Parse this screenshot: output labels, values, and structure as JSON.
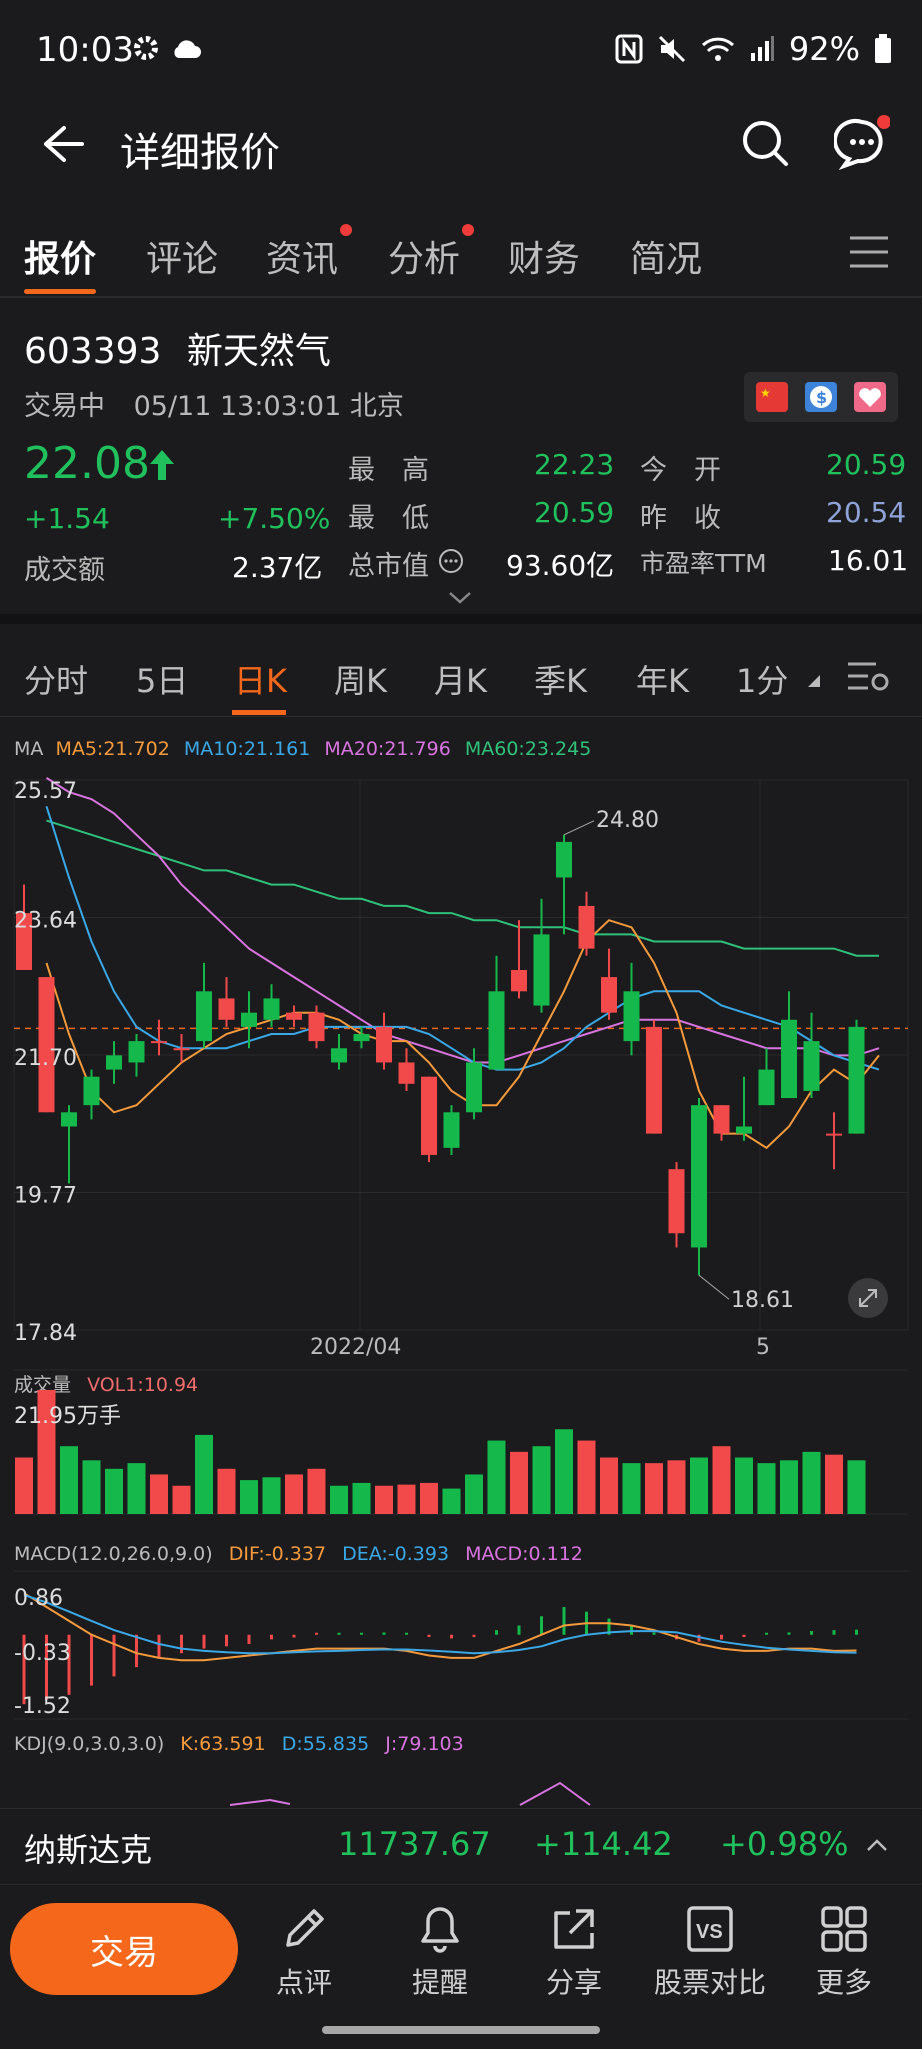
{
  "status": {
    "time": "10:03",
    "battery": "92%"
  },
  "header": {
    "title": "详细报价"
  },
  "tabs": [
    {
      "label": "报价",
      "active": true,
      "dot": false
    },
    {
      "label": "评论",
      "active": false,
      "dot": false
    },
    {
      "label": "资讯",
      "active": false,
      "dot": true
    },
    {
      "label": "分析",
      "active": false,
      "dot": true
    },
    {
      "label": "财务",
      "active": false,
      "dot": false
    },
    {
      "label": "简况",
      "active": false,
      "dot": false
    }
  ],
  "stock": {
    "code": "603393",
    "name": "新天然气",
    "status": "交易中",
    "datetime": "05/11 13:03:01 北京",
    "price": "22.08",
    "change": "+1.54",
    "change_pct": "+7.50%",
    "turnover_label": "成交额",
    "turnover": "2.37亿",
    "high_label": "最　高",
    "high": "22.23",
    "low_label": "最　低",
    "low": "20.59",
    "mcap_label": "总市值",
    "mcap": "93.60亿",
    "open_label": "今　开",
    "open": "20.59",
    "prev_close_label": "昨　收",
    "prev_close": "20.54",
    "pe_label": "市盈率TTM",
    "pe": "16.01"
  },
  "chart_tabs": [
    "分时",
    "5日",
    "日K",
    "周K",
    "月K",
    "季K",
    "年K",
    "1分"
  ],
  "chart_active_tab": "日K",
  "ma_legend": {
    "label": "MA",
    "ma5": "MA5:21.702",
    "ma10": "MA10:21.161",
    "ma20": "MA20:21.796",
    "ma60": "MA60:23.245"
  },
  "volume_legend": {
    "label": "成交量",
    "vol1": "VOL1:10.94",
    "max": "21.95万手"
  },
  "macd_legend": {
    "label": "MACD(12.0,26.0,9.0)",
    "dif": "DIF:-0.337",
    "dea": "DEA:-0.393",
    "macd": "MACD:0.112"
  },
  "kdj_legend": {
    "label": "KDJ(9.0,3.0,3.0)",
    "k": "K:63.591",
    "d": "D:55.835",
    "j": "J:79.103"
  },
  "colors": {
    "up": "#f24a4a",
    "down": "#14b84b",
    "ma5": "#f59a3c",
    "ma10": "#3aa8e6",
    "ma20": "#d874df",
    "ma60": "#2fc17a",
    "accent": "#f5681c"
  },
  "chart_data": {
    "type": "candlestick",
    "ylim": [
      17.84,
      25.57
    ],
    "y_ticks": [
      "25.57",
      "23.64",
      "21.70",
      "19.77",
      "17.84"
    ],
    "x_ticks": [
      "2022/04",
      "5"
    ],
    "annotations": [
      "24.80",
      "18.61"
    ],
    "last_price": 22.08,
    "candles": [
      {
        "o": 22.9,
        "c": 23.7,
        "h": 24.1,
        "l": 22.9,
        "up": true
      },
      {
        "o": 20.9,
        "c": 22.8,
        "h": 22.8,
        "l": 20.9,
        "up": true
      },
      {
        "o": 20.7,
        "c": 20.9,
        "h": 21.0,
        "l": 19.9,
        "up": false
      },
      {
        "o": 21.0,
        "c": 21.4,
        "h": 21.5,
        "l": 20.8,
        "up": false
      },
      {
        "o": 21.5,
        "c": 21.7,
        "h": 21.9,
        "l": 21.3,
        "up": false
      },
      {
        "o": 21.6,
        "c": 21.9,
        "h": 22.0,
        "l": 21.4,
        "up": false
      },
      {
        "o": 21.9,
        "c": 21.9,
        "h": 22.2,
        "l": 21.7,
        "up": true
      },
      {
        "o": 21.8,
        "c": 21.8,
        "h": 22.0,
        "l": 21.6,
        "up": true
      },
      {
        "o": 21.9,
        "c": 22.6,
        "h": 23.0,
        "l": 21.8,
        "up": false
      },
      {
        "o": 22.2,
        "c": 22.5,
        "h": 22.8,
        "l": 22.1,
        "up": true
      },
      {
        "o": 22.1,
        "c": 22.3,
        "h": 22.6,
        "l": 21.8,
        "up": false
      },
      {
        "o": 22.2,
        "c": 22.5,
        "h": 22.7,
        "l": 22.1,
        "up": false
      },
      {
        "o": 22.3,
        "c": 22.2,
        "h": 22.4,
        "l": 22.1,
        "up": true
      },
      {
        "o": 21.9,
        "c": 22.3,
        "h": 22.4,
        "l": 21.8,
        "up": true
      },
      {
        "o": 21.8,
        "c": 21.6,
        "h": 22.0,
        "l": 21.5,
        "up": false
      },
      {
        "o": 21.9,
        "c": 22.0,
        "h": 22.1,
        "l": 21.8,
        "up": false
      },
      {
        "o": 21.6,
        "c": 22.1,
        "h": 22.3,
        "l": 21.5,
        "up": true
      },
      {
        "o": 21.3,
        "c": 21.6,
        "h": 21.8,
        "l": 21.2,
        "up": true
      },
      {
        "o": 20.3,
        "c": 21.4,
        "h": 21.4,
        "l": 20.2,
        "up": true
      },
      {
        "o": 20.4,
        "c": 20.9,
        "h": 21.0,
        "l": 20.3,
        "up": false
      },
      {
        "o": 20.9,
        "c": 21.6,
        "h": 21.8,
        "l": 20.8,
        "up": false
      },
      {
        "o": 21.5,
        "c": 22.6,
        "h": 23.1,
        "l": 21.5,
        "up": false
      },
      {
        "o": 22.6,
        "c": 22.9,
        "h": 23.6,
        "l": 22.5,
        "up": true
      },
      {
        "o": 22.4,
        "c": 23.4,
        "h": 23.9,
        "l": 22.3,
        "up": false
      },
      {
        "o": 24.2,
        "c": 24.7,
        "h": 24.8,
        "l": 23.4,
        "up": false
      },
      {
        "o": 23.2,
        "c": 23.8,
        "h": 24.0,
        "l": 23.1,
        "up": true
      },
      {
        "o": 22.3,
        "c": 22.8,
        "h": 23.2,
        "l": 22.2,
        "up": true
      },
      {
        "o": 21.9,
        "c": 22.6,
        "h": 23.0,
        "l": 21.7,
        "up": false
      },
      {
        "o": 20.6,
        "c": 22.1,
        "h": 22.2,
        "l": 20.6,
        "up": true
      },
      {
        "o": 19.2,
        "c": 20.1,
        "h": 20.2,
        "l": 19.0,
        "up": true
      },
      {
        "o": 19.0,
        "c": 21.0,
        "h": 21.1,
        "l": 18.61,
        "up": false
      },
      {
        "o": 21.0,
        "c": 20.6,
        "h": 21.0,
        "l": 20.5,
        "up": true
      },
      {
        "o": 20.6,
        "c": 20.7,
        "h": 21.4,
        "l": 20.5,
        "up": false
      },
      {
        "o": 21.0,
        "c": 21.5,
        "h": 21.8,
        "l": 21.0,
        "up": false
      },
      {
        "o": 21.1,
        "c": 22.2,
        "h": 22.6,
        "l": 21.1,
        "up": false
      },
      {
        "o": 21.2,
        "c": 21.9,
        "h": 22.3,
        "l": 21.1,
        "up": false
      },
      {
        "o": 20.6,
        "c": 20.6,
        "h": 20.9,
        "l": 20.1,
        "up": true
      },
      {
        "o": 20.6,
        "c": 22.1,
        "h": 22.2,
        "l": 20.6,
        "up": false
      }
    ],
    "ma5": [
      23.0,
      22.0,
      21.2,
      20.9,
      21.0,
      21.3,
      21.6,
      21.8,
      22.0,
      22.1,
      22.2,
      22.3,
      22.3,
      22.2,
      22.0,
      21.9,
      21.9,
      21.6,
      21.2,
      21.0,
      21.0,
      21.4,
      22.0,
      22.6,
      23.3,
      23.6,
      23.5,
      23.0,
      22.3,
      21.2,
      20.6,
      20.6,
      20.4,
      20.7,
      21.2,
      21.5,
      21.3,
      21.7
    ],
    "ma10": [
      25.2,
      24.2,
      23.3,
      22.6,
      22.1,
      21.9,
      21.8,
      21.8,
      21.8,
      21.9,
      22.0,
      22.0,
      22.1,
      22.1,
      22.1,
      22.1,
      22.1,
      22.0,
      21.8,
      21.6,
      21.5,
      21.5,
      21.6,
      21.8,
      22.1,
      22.3,
      22.5,
      22.6,
      22.6,
      22.6,
      22.4,
      22.3,
      22.2,
      22.1,
      21.9,
      21.7,
      21.6,
      21.5
    ],
    "ma20": [
      25.6,
      25.4,
      25.3,
      25.1,
      24.8,
      24.5,
      24.1,
      23.8,
      23.5,
      23.2,
      23.0,
      22.8,
      22.6,
      22.4,
      22.2,
      22.0,
      21.9,
      21.8,
      21.7,
      21.6,
      21.6,
      21.7,
      21.8,
      21.9,
      22.0,
      22.1,
      22.2,
      22.2,
      22.2,
      22.1,
      22.0,
      21.9,
      21.8,
      21.8,
      21.8,
      21.7,
      21.7,
      21.8
    ],
    "ma60": [
      25.0,
      24.9,
      24.8,
      24.7,
      24.6,
      24.5,
      24.4,
      24.3,
      24.3,
      24.2,
      24.1,
      24.1,
      24.0,
      23.9,
      23.9,
      23.8,
      23.8,
      23.7,
      23.7,
      23.6,
      23.6,
      23.5,
      23.5,
      23.5,
      23.4,
      23.4,
      23.4,
      23.3,
      23.3,
      23.3,
      23.3,
      23.2,
      23.2,
      23.2,
      23.2,
      23.2,
      23.1,
      23.1
    ],
    "volume": [
      10,
      21.95,
      12,
      9.5,
      8,
      9,
      7,
      5,
      14,
      8,
      6,
      6.5,
      7,
      8,
      5,
      5.5,
      5,
      5.2,
      5.5,
      4.5,
      7,
      13,
      11,
      12,
      15,
      13,
      10,
      9,
      9,
      9.5,
      10,
      12,
      10,
      9,
      9.5,
      11,
      10.5,
      9.5
    ],
    "macd_bars": [
      -1.5,
      -1.4,
      -1.3,
      -1.1,
      -0.9,
      -0.7,
      -0.5,
      -0.4,
      -0.3,
      -0.25,
      -0.2,
      -0.1,
      -0.06,
      -0.03,
      0.02,
      0.03,
      0.05,
      0.03,
      -0.05,
      -0.08,
      -0.05,
      0.1,
      0.2,
      0.4,
      0.6,
      0.5,
      0.35,
      0.2,
      0.05,
      -0.1,
      -0.15,
      -0.1,
      -0.05,
      0.02,
      0.05,
      0.08,
      0.1,
      0.11
    ],
    "dif": [
      0.9,
      0.6,
      0.3,
      0.0,
      -0.2,
      -0.4,
      -0.5,
      -0.55,
      -0.55,
      -0.5,
      -0.45,
      -0.4,
      -0.35,
      -0.3,
      -0.3,
      -0.3,
      -0.3,
      -0.35,
      -0.45,
      -0.5,
      -0.5,
      -0.35,
      -0.2,
      0.0,
      0.2,
      0.25,
      0.25,
      0.2,
      0.1,
      -0.05,
      -0.2,
      -0.3,
      -0.35,
      -0.35,
      -0.3,
      -0.3,
      -0.35,
      -0.34
    ],
    "dea": [
      0.86,
      0.7,
      0.5,
      0.3,
      0.1,
      -0.05,
      -0.2,
      -0.3,
      -0.35,
      -0.38,
      -0.4,
      -0.4,
      -0.38,
      -0.36,
      -0.35,
      -0.33,
      -0.32,
      -0.32,
      -0.34,
      -0.37,
      -0.4,
      -0.38,
      -0.33,
      -0.25,
      -0.1,
      0.0,
      0.05,
      0.08,
      0.08,
      0.05,
      -0.05,
      -0.15,
      -0.22,
      -0.28,
      -0.32,
      -0.35,
      -0.38,
      -0.39
    ],
    "macd_ylim": [
      -1.52,
      0.86
    ],
    "macd_ticks": [
      "0.86",
      "-0.33",
      "-1.52"
    ]
  },
  "index_bar": {
    "name": "纳斯达克",
    "value": "11737.67",
    "change": "+114.42",
    "change_pct": "+0.98%"
  },
  "bottom": {
    "trade": "交易",
    "review": "点评",
    "alert": "提醒",
    "share": "分享",
    "compare": "股票对比",
    "more": "更多"
  }
}
